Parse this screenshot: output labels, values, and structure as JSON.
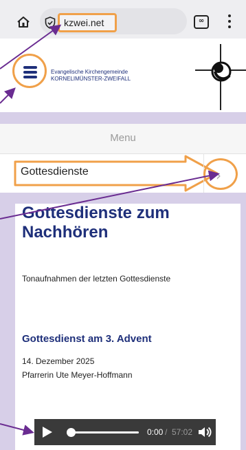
{
  "browser": {
    "url": "kzwei.net",
    "tab_count": "∞",
    "icons": [
      "home-icon",
      "shield-icon",
      "tabs-icon",
      "more-vertical-icon"
    ]
  },
  "site": {
    "org_line_1": "Evangelische Kirchengemeinde",
    "org_line_2": "KORNELIMÜNSTER-ZWEIFALL",
    "brand_color": "#1e2f7a"
  },
  "menu": {
    "title": "Menu",
    "items": [
      {
        "label": "Gottesdienste"
      }
    ]
  },
  "content": {
    "title": "Gottesdienste zum Nachhören",
    "intro": "Tonaufnahmen der letzten Gottesdienste",
    "sermon": {
      "title": "Gottesdienst am 3. Advent",
      "date": "14. Dezember 2025",
      "speaker": "Pfarrerin Ute Meyer-Hoffmann"
    },
    "player": {
      "current_time": "0:00",
      "separator": "/",
      "duration": "57:02",
      "progress": 0
    }
  },
  "annotation_color": "#f0a049",
  "arrow_color": "#6a2c91"
}
